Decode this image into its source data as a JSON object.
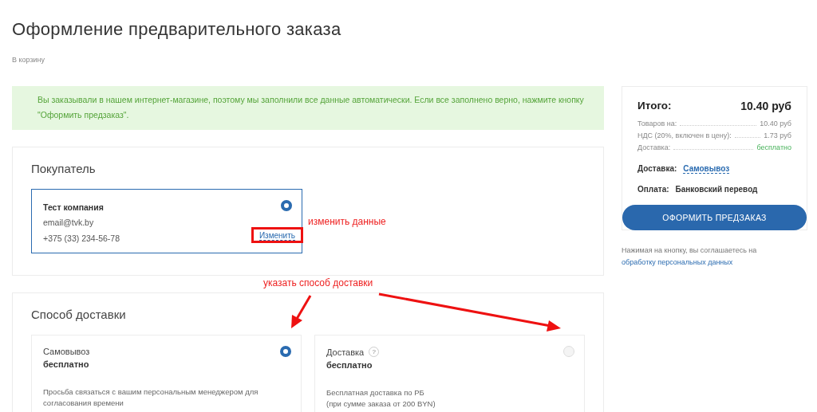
{
  "page": {
    "title": "Оформление предварительного заказа",
    "breadcrumb": "В корзину"
  },
  "notice": {
    "text": "Вы заказывали в нашем интернет-магазине, поэтому мы заполнили все данные автоматически. Если все заполнено верно, нажмите кнопку \"Оформить предзаказ\"."
  },
  "buyer": {
    "heading": "Покупатель",
    "profiles": [
      {
        "name": "Тест компания",
        "email": "email@tvk.by",
        "phone": "+375 (33) 234-56-78",
        "edit_link": "Изменить",
        "selected": true
      }
    ],
    "note": "изменить данные"
  },
  "delivery": {
    "heading": "Способ доставки",
    "note": "указать способ доставки",
    "options": [
      {
        "name": "Самовывоз",
        "price": "бесплатно",
        "description_lines": [
          "Просьба связаться с вашим персональным менеджером для согласования времени"
        ],
        "selected": true
      },
      {
        "name": "Доставка",
        "help": "?",
        "price": "бесплатно",
        "description_lines": [
          "Бесплатная доставка по РБ",
          "(при сумме заказа от 200 BYN)"
        ],
        "selected": false
      }
    ]
  },
  "summary": {
    "total_label": "Итого:",
    "total": "10.40 руб",
    "lines": [
      {
        "label": "Товаров на:",
        "value": "10.40 руб",
        "kind": "plain"
      },
      {
        "label": "НДС (20%, включен в цену):",
        "value": "1.73 руб",
        "kind": "plain"
      },
      {
        "label": "Доставка:",
        "value": "бесплатно",
        "kind": "free"
      }
    ],
    "delivery_label": "Доставка:",
    "delivery_value": "Самовывоз",
    "payment_label": "Оплата:",
    "payment_value": "Банковский перевод",
    "submit": "ОФОРМИТЬ ПРЕДЗАКАЗ",
    "consent_text": "Нажимая на кнопку, вы соглашаетесь на",
    "consent_link": "обработку персональных данных"
  }
}
